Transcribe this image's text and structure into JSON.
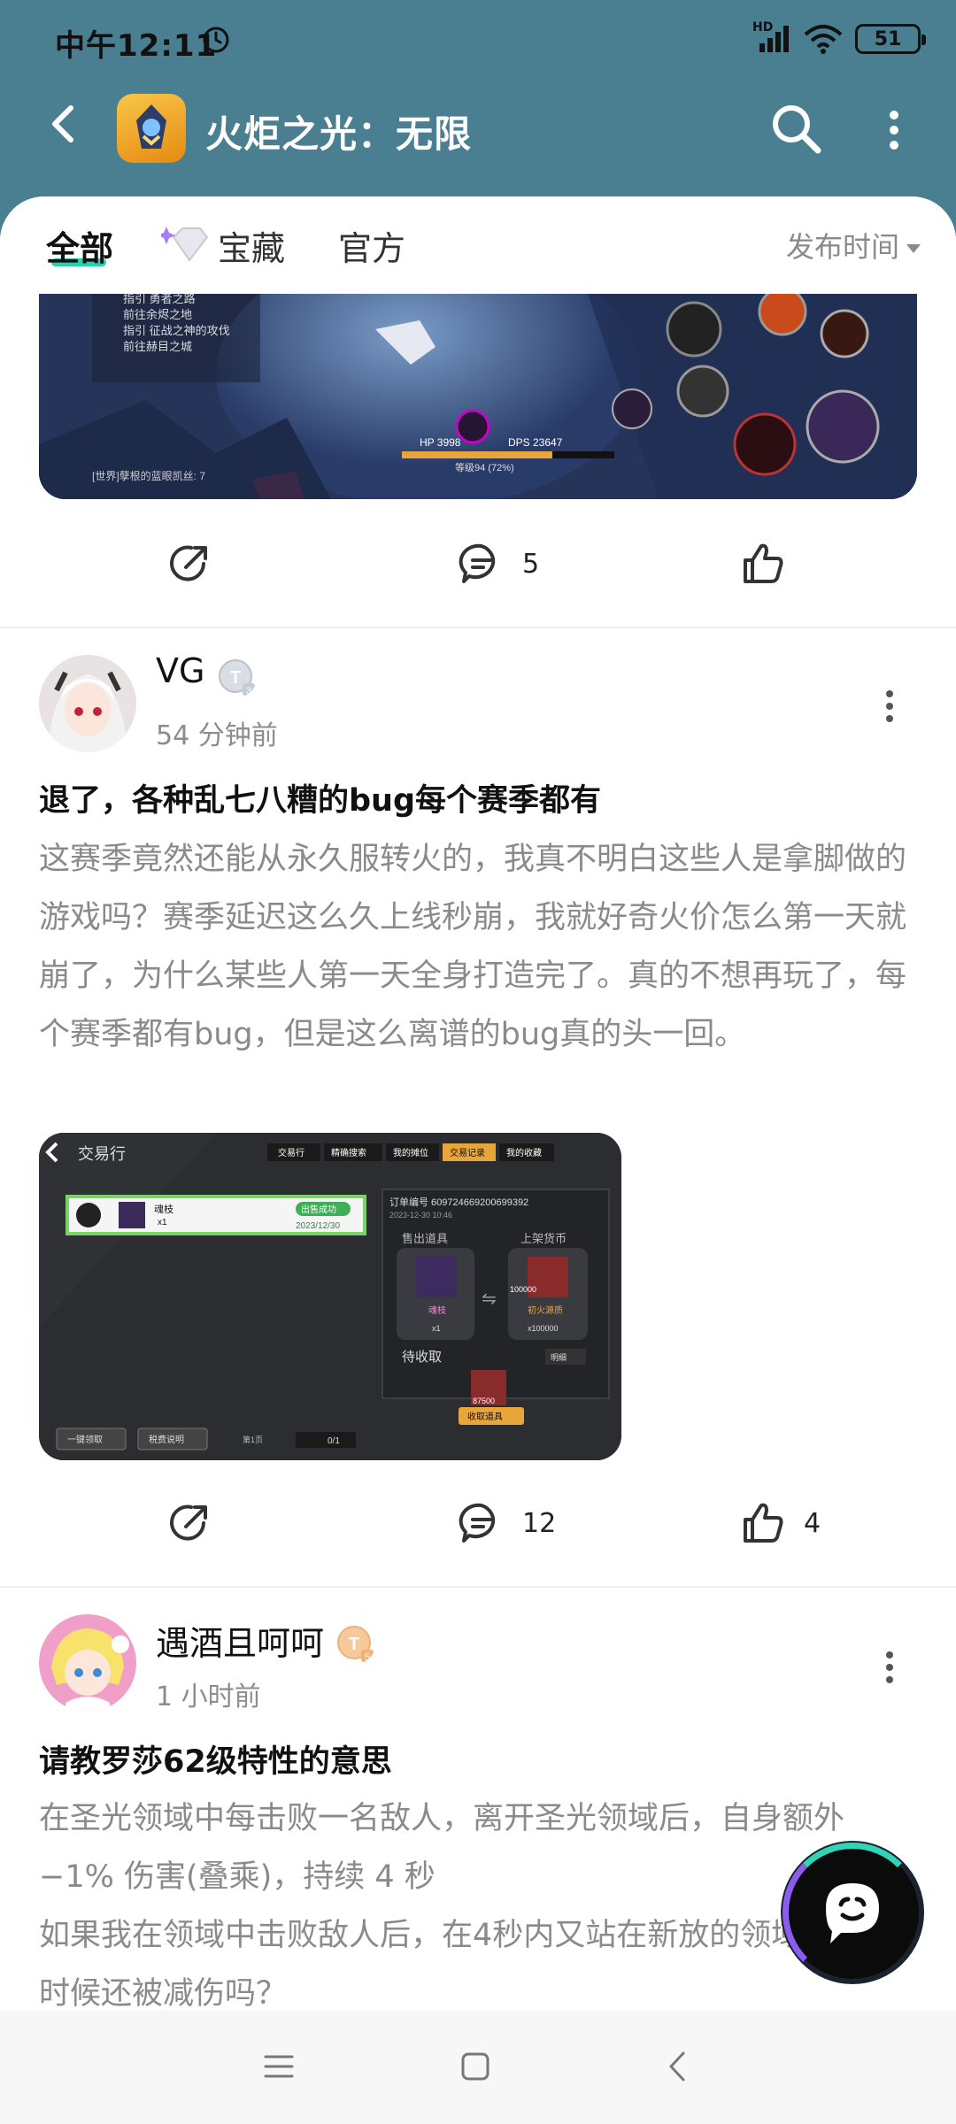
{
  "status": {
    "time": "中午12:11",
    "network": "HD",
    "battery": "51"
  },
  "header": {
    "title": "火炬之光：无限"
  },
  "tabs": {
    "all": "全部",
    "treasure": "宝藏",
    "official": "官方",
    "sort": "发布时间"
  },
  "posts": [
    {
      "share_label": "",
      "comment_count": "5",
      "like_count": ""
    },
    {
      "author": "VG",
      "level": "T3",
      "time": "54 分钟前",
      "title": "退了，各种乱七八糟的bug每个赛季都有",
      "body": "这赛季竟然还能从永久服转火的，我真不明白这些人是拿脚做的游戏吗？赛季延迟这么久上线秒崩，我就好奇火价怎么第一天就崩了，为什么某些人第一天全身打造完了。真的不想再玩了，每个赛季都有bug，但是这么离谱的bug真的头一回。",
      "comment_count": "12",
      "like_count": "4",
      "image": {
        "back_title": "交易行",
        "tabs": [
          "交易行",
          "精确搜索",
          "我的摊位",
          "交易记录",
          "我的收藏"
        ],
        "item_name": "魂枝",
        "item_qty": "x1",
        "status": "出售成功",
        "date": "2023/12/30",
        "order_no": "订单编号 609724669200699392",
        "order_time": "2023-12-30 10:46",
        "sold_label": "售出道具",
        "currency_label": "上架货币",
        "sold_item": "魂枝",
        "sold_qty": "x1",
        "currency_item": "初火源质",
        "currency_amount": "100000",
        "currency_qty": "x100000",
        "pending_label": "待收取",
        "detail_label": "明细",
        "pending_amount": "87500",
        "collect_btn": "收取道具",
        "claim_all": "一键领取",
        "tax": "税费说明",
        "page": "第1页",
        "page_count": "0/1"
      }
    },
    {
      "author": "遇酒且呵呵",
      "level": "T5",
      "time": "1 小时前",
      "title": "请教罗莎62级特性的意思",
      "body_line1": "在圣光领域中每击败一名敌人，离开圣光领域后，自身额外 −1% 伤害(叠乘)，持续 4 秒",
      "body_line2": "如果我在领域中击败敌人后，在4秒内又站在新放的领域中，这时候还被减伤吗？"
    }
  ],
  "top_image_text": {
    "menu1": "指引 勇者之路",
    "menu2": "前往余烬之地",
    "menu3": "指引 征战之神的攻伐",
    "menu4": "前往赫目之城",
    "hp": "HP 3998",
    "dps": "DPS 23647",
    "level": "等级94 (72%)",
    "chat": "[世界]孽根的蓝眼凯丝: 7"
  }
}
